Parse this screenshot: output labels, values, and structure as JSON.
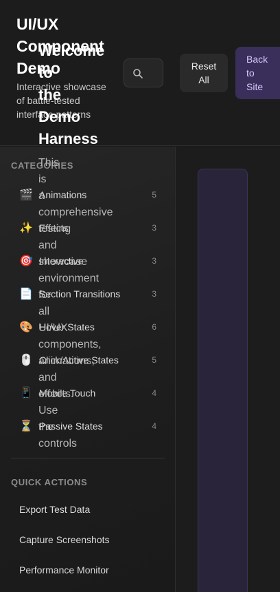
{
  "header": {
    "title": "UI/UX Component Demo",
    "subtitle": "Interactive showcase of battle-tested interface patterns",
    "reset_label": "Reset All",
    "back_label": "Back to Site"
  },
  "sidebar": {
    "categories_heading": "CATEGORIES",
    "categories": [
      {
        "icon": "🎬",
        "icon_name": "clapperboard-icon",
        "label": "Animations",
        "count": "5"
      },
      {
        "icon": "✨",
        "icon_name": "sparkles-icon",
        "label": "Effects",
        "count": "3"
      },
      {
        "icon": "🎯",
        "icon_name": "target-icon",
        "label": "Interactive",
        "count": "3"
      },
      {
        "icon": "📄",
        "icon_name": "document-icon",
        "label": "Section Transitions",
        "count": "3"
      },
      {
        "icon": "🎨",
        "icon_name": "palette-icon",
        "label": "Hover States",
        "count": "6"
      },
      {
        "icon": "🖱️",
        "icon_name": "mouse-icon",
        "label": "Click/Active States",
        "count": "5"
      },
      {
        "icon": "📱",
        "icon_name": "mobile-phone-icon",
        "label": "Mobile Touch",
        "count": "4"
      },
      {
        "icon": "⏳",
        "icon_name": "hourglass-icon",
        "label": "Passive States",
        "count": "4"
      }
    ],
    "quick_actions_heading": "QUICK ACTIONS",
    "quick_actions": [
      {
        "label": "Export Test Data"
      },
      {
        "label": "Capture Screenshots"
      },
      {
        "label": "Performance Monitor"
      }
    ]
  },
  "main": {
    "welcome_title_lines": [
      "Welcome",
      "to",
      "the",
      "Demo",
      "Harness"
    ],
    "welcome_body_lines": [
      "This",
      "is",
      "a",
      "comprehensive",
      "testing",
      "and",
      "showcase",
      "environment",
      "for",
      "all",
      "UI/UX",
      "components,",
      "animations,",
      "and",
      "effects.",
      "Use",
      "the",
      "controls"
    ]
  }
}
